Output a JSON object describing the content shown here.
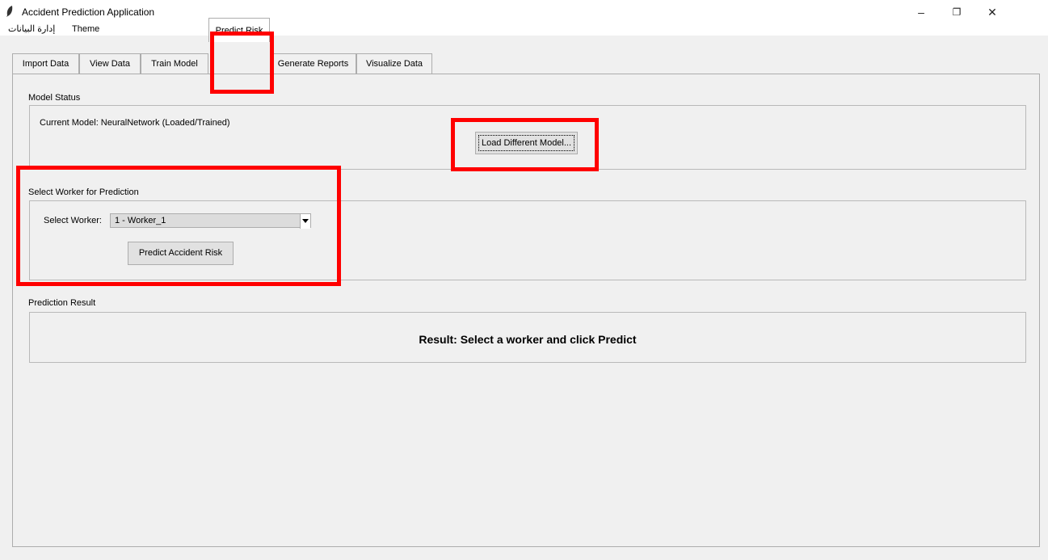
{
  "window": {
    "title": "Accident Prediction Application",
    "controls": {
      "minimize": "–",
      "maximize": "❐",
      "close": "✕"
    }
  },
  "menubar": {
    "items": [
      "إدارة البيانات",
      "Theme"
    ]
  },
  "tabs": [
    {
      "label": "Import Data",
      "active": false
    },
    {
      "label": "View Data",
      "active": false
    },
    {
      "label": "Train Model",
      "active": false
    },
    {
      "label": "Predict Risk",
      "active": true
    },
    {
      "label": "Generate Reports",
      "active": false
    },
    {
      "label": "Visualize Data",
      "active": false
    }
  ],
  "model_status": {
    "title": "Model Status",
    "current_model": "Current Model: NeuralNetwork (Loaded/Trained)",
    "load_button": "Load Different Model..."
  },
  "worker_select": {
    "title": "Select Worker for Prediction",
    "label": "Select Worker:",
    "selected": "1 - Worker_1",
    "predict_button": "Predict Accident Risk"
  },
  "result": {
    "title": "Prediction Result",
    "text": "Result: Select a worker and click Predict"
  },
  "colors": {
    "annotation": "#ff0000",
    "background": "#f0f0f0"
  }
}
